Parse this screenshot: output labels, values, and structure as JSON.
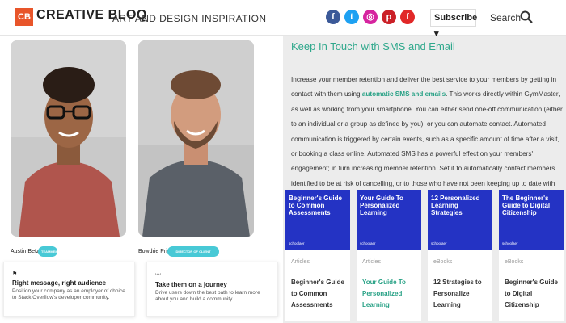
{
  "header": {
    "logo_mark": "CB",
    "logo_text": "CREATIVE BLOQ",
    "tagline": "ART AND DESIGN INSPIRATION",
    "social": [
      {
        "name": "facebook-icon",
        "glyph": "f",
        "color": "#3b5998"
      },
      {
        "name": "twitter-icon",
        "glyph": "t",
        "color": "#1da1f2"
      },
      {
        "name": "instagram-icon",
        "glyph": "◎",
        "color": "#d6249f"
      },
      {
        "name": "pinterest-icon",
        "glyph": "p",
        "color": "#cb2027"
      },
      {
        "name": "flipboard-icon",
        "glyph": "f",
        "color": "#e12828"
      }
    ],
    "subscribe_label": "Subscribe ▾",
    "search_label": "Search"
  },
  "people": [
    {
      "name": "Austin Betzer",
      "badge": "TEAMMEMBER"
    },
    {
      "name": "Bowdrie Price",
      "badge": "DIRECTOR OF CLIENT OPERATIONS"
    }
  ],
  "cards": [
    {
      "icon": "⚑",
      "title": "Right message, right audience",
      "desc": "Position your company as an employer of choice to Stack Overflow's developer community."
    },
    {
      "icon": "〰",
      "title": "Take them on a journey",
      "desc": "Drive users down the best path to learn more about you and build a community."
    }
  ],
  "sms": {
    "title": "Keep In Touch with SMS and Email",
    "body_before": "Increase your member retention and deliver the best service to your members by getting in contact with them using ",
    "link_text": "automatic SMS and emails",
    "body_after": ". This works directly within GymMaster, as well as working from your smartphone. You can either send one-off communication (either to an individual or a group as defined by you), or you can automate contact. Automated communication is triggered by certain events, such as a specific amount of time after a visit, or booking a class online. Automated SMS has a powerful effect on your members' engagement; in turn increasing member retention. Set it to automatically contact members identified to be at risk of cancelling, or to those who have not been keeping up to date with their payments."
  },
  "articles": [
    {
      "thumb_title": "Beginner's Guide to Common Assessments",
      "brand": "schoolaer",
      "category": "Articles",
      "title": "Beginner's Guide to Common Assessments",
      "link": false
    },
    {
      "thumb_title": "Your Guide To Personalized Learning",
      "brand": "schoolaer",
      "category": "Articles",
      "title": "Your Guide To Personalized Learning",
      "link": true
    },
    {
      "thumb_title": "12 Personalized Learning Strategies",
      "brand": "schoolaer",
      "category": "eBooks",
      "title": "12 Strategies to Personalize Learning",
      "link": false
    },
    {
      "thumb_title": "The Beginner's Guide to Digital Citizenship",
      "brand": "schoolaer",
      "category": "eBooks",
      "title": "Beginner's Guide to Digital Citizenship",
      "link": false
    }
  ]
}
